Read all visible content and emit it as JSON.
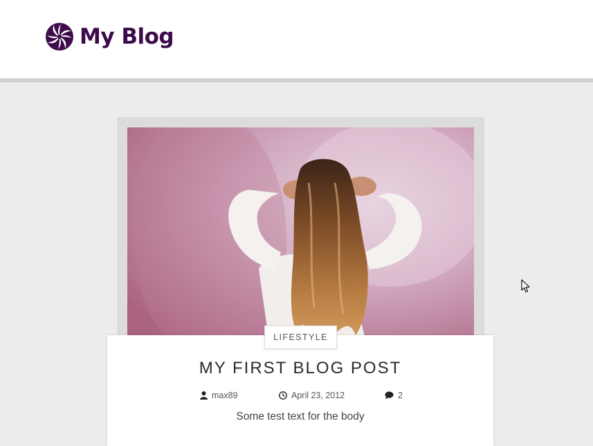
{
  "site": {
    "title": "My Blog",
    "logo_icon": "swirl-logo-icon",
    "brand_color": "#3d0b4a"
  },
  "post": {
    "category": "LIFESTYLE",
    "title": "MY FIRST BLOG POST",
    "author": "max89",
    "date": "April 23, 2012",
    "comments": "2",
    "excerpt": "Some test text for the body",
    "image_icon": "featured-photo",
    "meta_icons": [
      "user-icon",
      "clock-icon",
      "comment-icon"
    ]
  },
  "pointer": "mouse-cursor-icon"
}
